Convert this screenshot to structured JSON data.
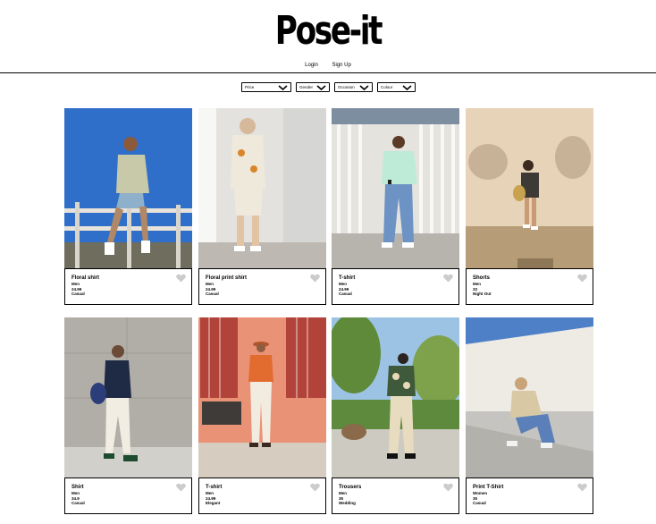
{
  "brand": "Pose-it",
  "auth": {
    "login": "Login",
    "signup": "Sign Up"
  },
  "filters": [
    {
      "label": "Price"
    },
    {
      "label": "Gender"
    },
    {
      "label": "Occasion"
    },
    {
      "label": "Colour"
    }
  ],
  "products": [
    {
      "name": "Floral shirt",
      "gender": "Men",
      "price": "24.99",
      "occasion": "Casual"
    },
    {
      "name": "Floral print shirt",
      "gender": "Men",
      "price": "24.99",
      "occasion": "Casual"
    },
    {
      "name": "T-shirt",
      "gender": "Men",
      "price": "24.99",
      "occasion": "Casual"
    },
    {
      "name": "Shorts",
      "gender": "Men",
      "price": "33",
      "occasion": "Night Out"
    },
    {
      "name": "Shirt",
      "gender": "Men",
      "price": "34.9",
      "occasion": "Casual"
    },
    {
      "name": "T-shirt",
      "gender": "Men",
      "price": "24.99",
      "occasion": "Elegant"
    },
    {
      "name": "Trousers",
      "gender": "Men",
      "price": "35",
      "occasion": "Wedding"
    },
    {
      "name": "Print T-Shirt",
      "gender": "Women",
      "price": "35",
      "occasion": "Casual"
    }
  ],
  "icons": {
    "heart": "heart-icon",
    "dropdown": "chevron-down-icon"
  },
  "colors": {
    "text": "#000000",
    "heart": "#cccccc",
    "background": "#ffffff"
  }
}
